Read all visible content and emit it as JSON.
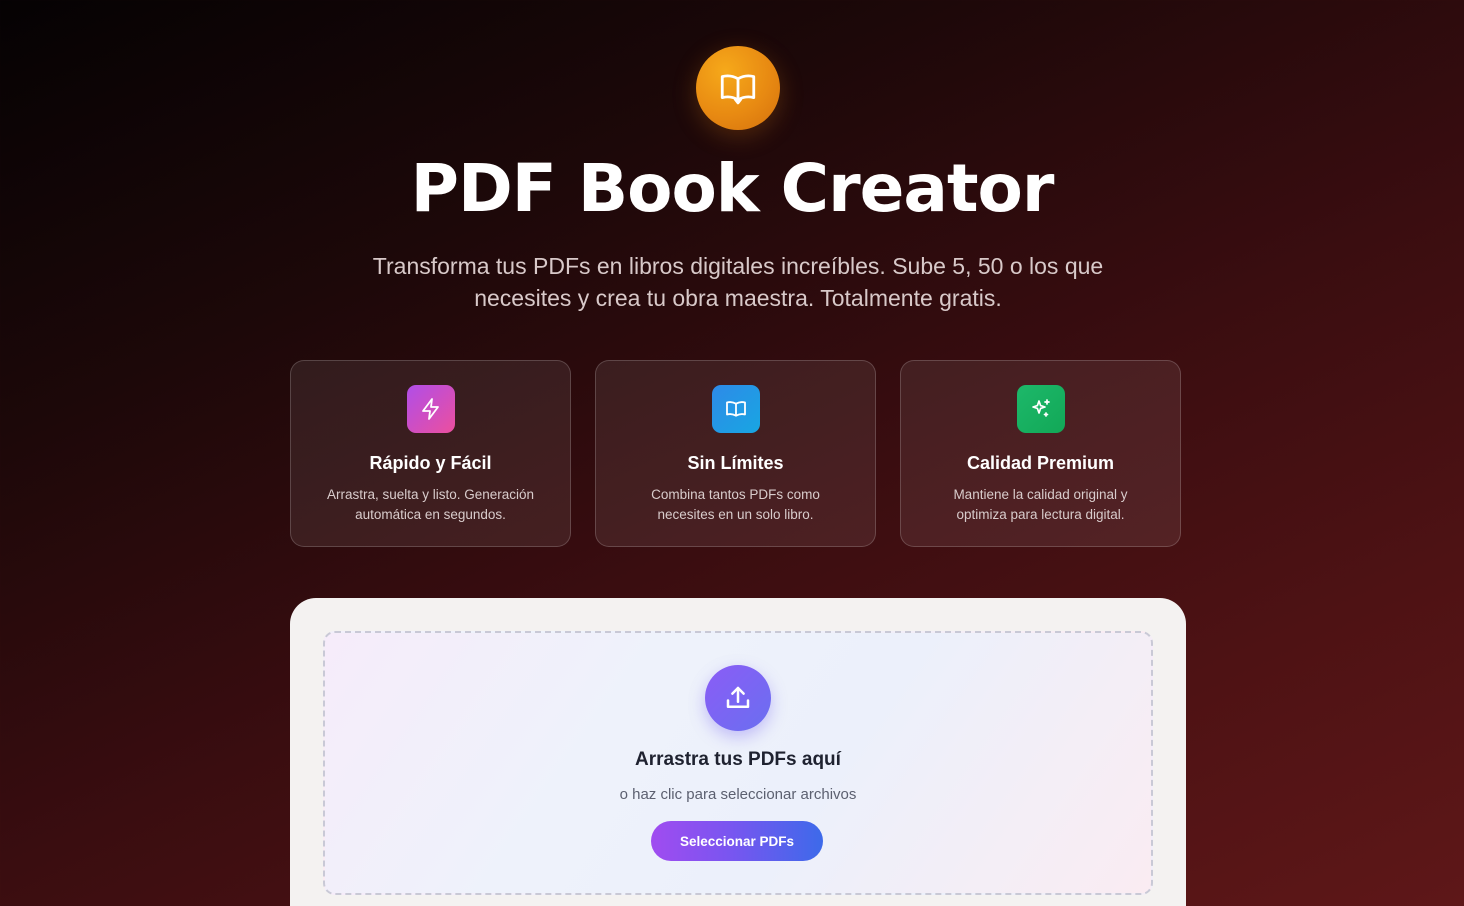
{
  "header": {
    "logo_icon": "book-open-icon",
    "title": "PDF Book Creator",
    "subtitle": "Transforma tus PDFs en libros digitales increíbles. Sube 5, 50 o los que necesites y crea tu obra maestra. Totalmente gratis."
  },
  "features": [
    {
      "icon": "zap-icon",
      "color": "#c44ecb",
      "title": "Rápido y Fácil",
      "description": "Arrastra, suelta y listo. Generación automática en segundos."
    },
    {
      "icon": "book-open-icon",
      "color": "#2196e6",
      "title": "Sin Límites",
      "description": "Combina tantos PDFs como necesites en un solo libro."
    },
    {
      "icon": "sparkles-icon",
      "color": "#19b062",
      "title": "Calidad Premium",
      "description": "Mantiene la calidad original y optimiza para lectura digital."
    }
  ],
  "upload": {
    "icon": "upload-icon",
    "title": "Arrastra tus PDFs aquí",
    "subtitle": "o haz clic para seleccionar archivos",
    "button_label": "Seleccionar PDFs"
  },
  "colors": {
    "accent_orange": "#e88a12",
    "accent_purple": "#8b5cf6",
    "accent_blue": "#3d6aea"
  }
}
